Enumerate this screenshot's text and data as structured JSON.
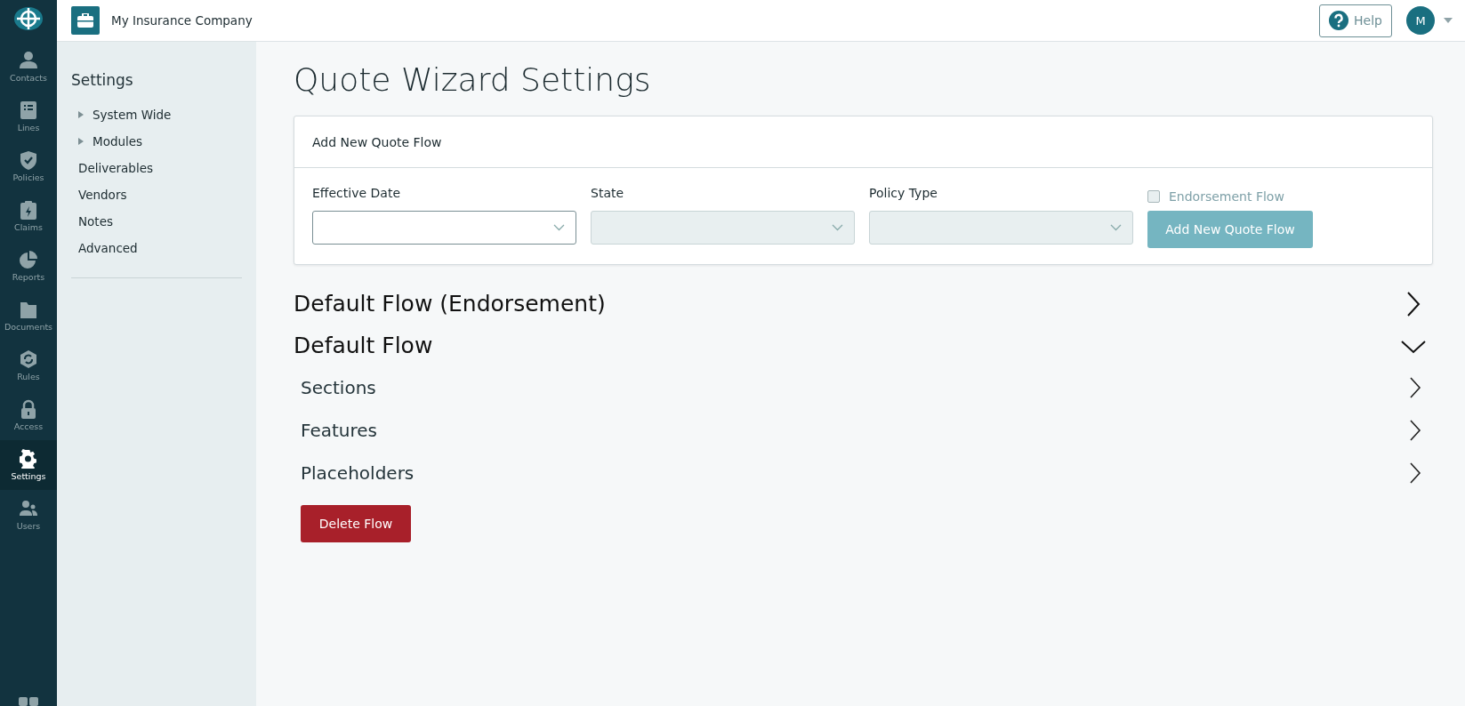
{
  "topbar": {
    "company": "My Insurance Company",
    "help": "Help",
    "avatar": "M"
  },
  "nav": [
    {
      "label": "Contacts",
      "selected": false
    },
    {
      "label": "Lines",
      "selected": false
    },
    {
      "label": "Policies",
      "selected": false
    },
    {
      "label": "Claims",
      "selected": false
    },
    {
      "label": "Reports",
      "selected": false
    },
    {
      "label": "Documents",
      "selected": false
    },
    {
      "label": "Rules",
      "selected": false
    },
    {
      "label": "Access",
      "selected": false
    },
    {
      "label": "Settings",
      "selected": true
    },
    {
      "label": "Users",
      "selected": false
    }
  ],
  "sidebar": {
    "title": "Settings",
    "items": [
      {
        "label": "System Wide",
        "kind": "group",
        "expanded": false
      },
      {
        "label": "Modules",
        "kind": "group",
        "expanded": false
      },
      {
        "label": "Deliverables",
        "kind": "link"
      },
      {
        "label": "Vendors",
        "kind": "link"
      },
      {
        "label": "Notes",
        "kind": "link"
      },
      {
        "label": "Advanced",
        "kind": "link"
      }
    ]
  },
  "page_title": "Quote Wizard Settings",
  "add_card": {
    "title": "Add New Quote Flow",
    "fields": [
      {
        "label": "Effective Date",
        "disabled": false
      },
      {
        "label": "State",
        "disabled": true
      },
      {
        "label": "Policy Type",
        "disabled": true
      }
    ],
    "checkbox": {
      "label": "Endorsement Flow",
      "checked": false,
      "disabled": true
    },
    "button": {
      "label": "Add New Quote Flow",
      "disabled": true
    }
  },
  "flows": [
    {
      "title": "Default Flow (Endorsement)",
      "expanded": false
    },
    {
      "title": "Default Flow",
      "expanded": true,
      "children": [
        {
          "title": "Sections",
          "expanded": false
        },
        {
          "title": "Features",
          "expanded": false
        },
        {
          "title": "Placeholders",
          "expanded": false
        }
      ],
      "delete_button": "Delete Flow"
    }
  ]
}
